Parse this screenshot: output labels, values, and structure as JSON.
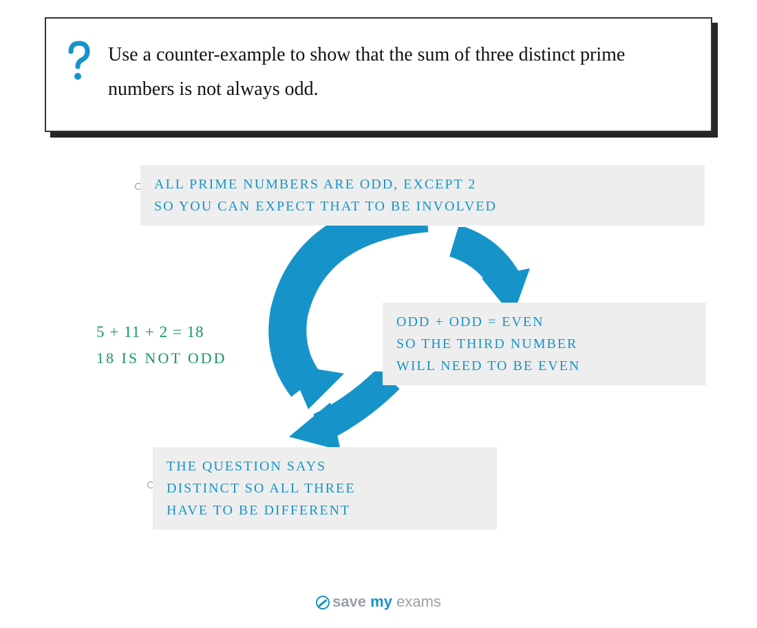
{
  "question": {
    "text": "Use a counter-example to show that the sum of three distinct prime numbers is not always odd."
  },
  "note1": {
    "line1": "ALL  PRIME  NUMBERS  ARE  ODD,  EXCEPT  2",
    "line2": "SO  YOU  CAN  EXPECT  THAT  TO  BE  INVOLVED"
  },
  "note2": {
    "line1": "ODD + ODD = EVEN",
    "line2": "SO  THE  THIRD  NUMBER",
    "line3": "WILL  NEED  TO  BE  EVEN"
  },
  "note3": {
    "line1": "THE  QUESTION  SAYS",
    "line2": "DISTINCT  SO  ALL  THREE",
    "line3": "HAVE  TO  BE  DIFFERENT"
  },
  "answer": {
    "line1": "5 + 11 + 2 = 18",
    "line2": "18  IS  NOT  ODD"
  },
  "brand": {
    "part1": "save",
    "part2": "my",
    "part3": "exams"
  }
}
